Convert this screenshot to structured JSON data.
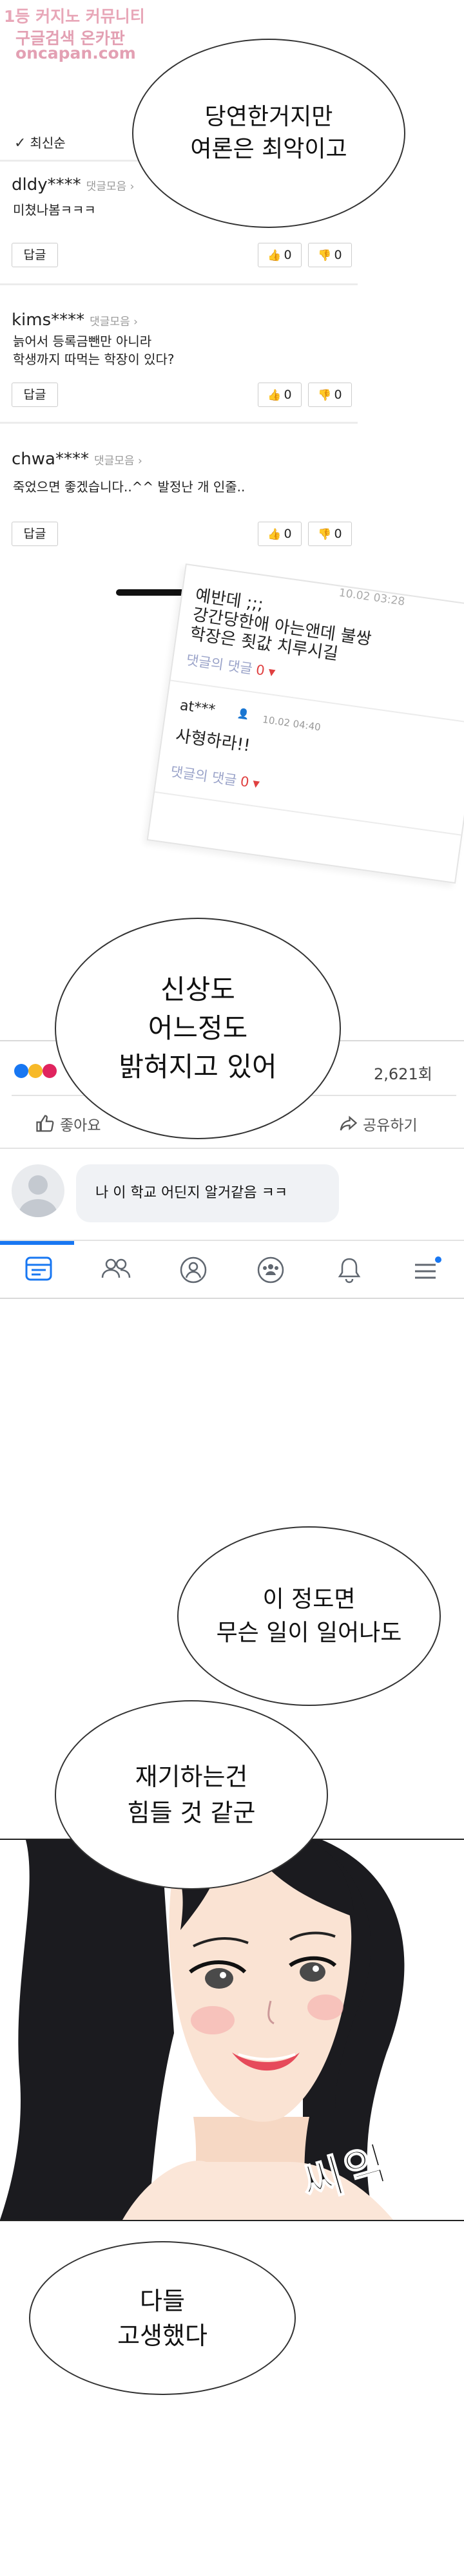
{
  "watermark": {
    "line1": "1등 커지노 커뮤니티",
    "line2": "구글검색 온카판",
    "line3": "oncapan.com"
  },
  "comments_panel": {
    "sort_label": "최신순",
    "comments": [
      {
        "user": "dldy****",
        "more": "댓글모음",
        "text": "미쳤나봄ㅋㅋㅋ",
        "reply_label": "답글",
        "likes": "0",
        "dislikes": "0"
      },
      {
        "user": "kims****",
        "more": "댓글모음",
        "text_lines": [
          "늙어서 등록금뺀만 아니라",
          "학생까지 따먹는 학장이 있다?"
        ],
        "reply_label": "답글",
        "likes": "0",
        "dislikes": "0"
      },
      {
        "user": "chwa****",
        "more": "댓글모음",
        "text": "죽었으면 좋겠습니다..^^ 발정난 개 인줄..",
        "reply_label": "답글",
        "likes": "0",
        "dislikes": "0"
      }
    ]
  },
  "bubbles": {
    "b1": [
      "당연한거지만",
      "여론은 최악이고"
    ],
    "b2": [
      "신상도",
      "어느정도",
      "밝혀지고 있어"
    ],
    "b3": [
      "이 정도면",
      "무슨 일이 일어나도"
    ],
    "b4": [
      "재기하는건",
      "힘들 것 같군"
    ],
    "b5": [
      "다들",
      "고생했다"
    ]
  },
  "tilted_panel": {
    "date_top": "10.02 03:28",
    "text_lines": [
      "예반데 ;;;",
      "강간당한애 아는앤데 불쌍",
      "학장은 죗값 치루시길"
    ],
    "reply_label": "댓글의 댓글",
    "reply_count": "0",
    "user": "at***",
    "date": "10.02 04:40",
    "text2": "사형하라!!",
    "reply_count2": "0"
  },
  "facebook": {
    "views": "2,621회",
    "like_label": "좋아요",
    "share_label": "공유하기",
    "comment": "나 이 학교 어딘지 알거같음 ㅋㅋ",
    "accent": "#1877f2"
  },
  "sfx": "씨익"
}
